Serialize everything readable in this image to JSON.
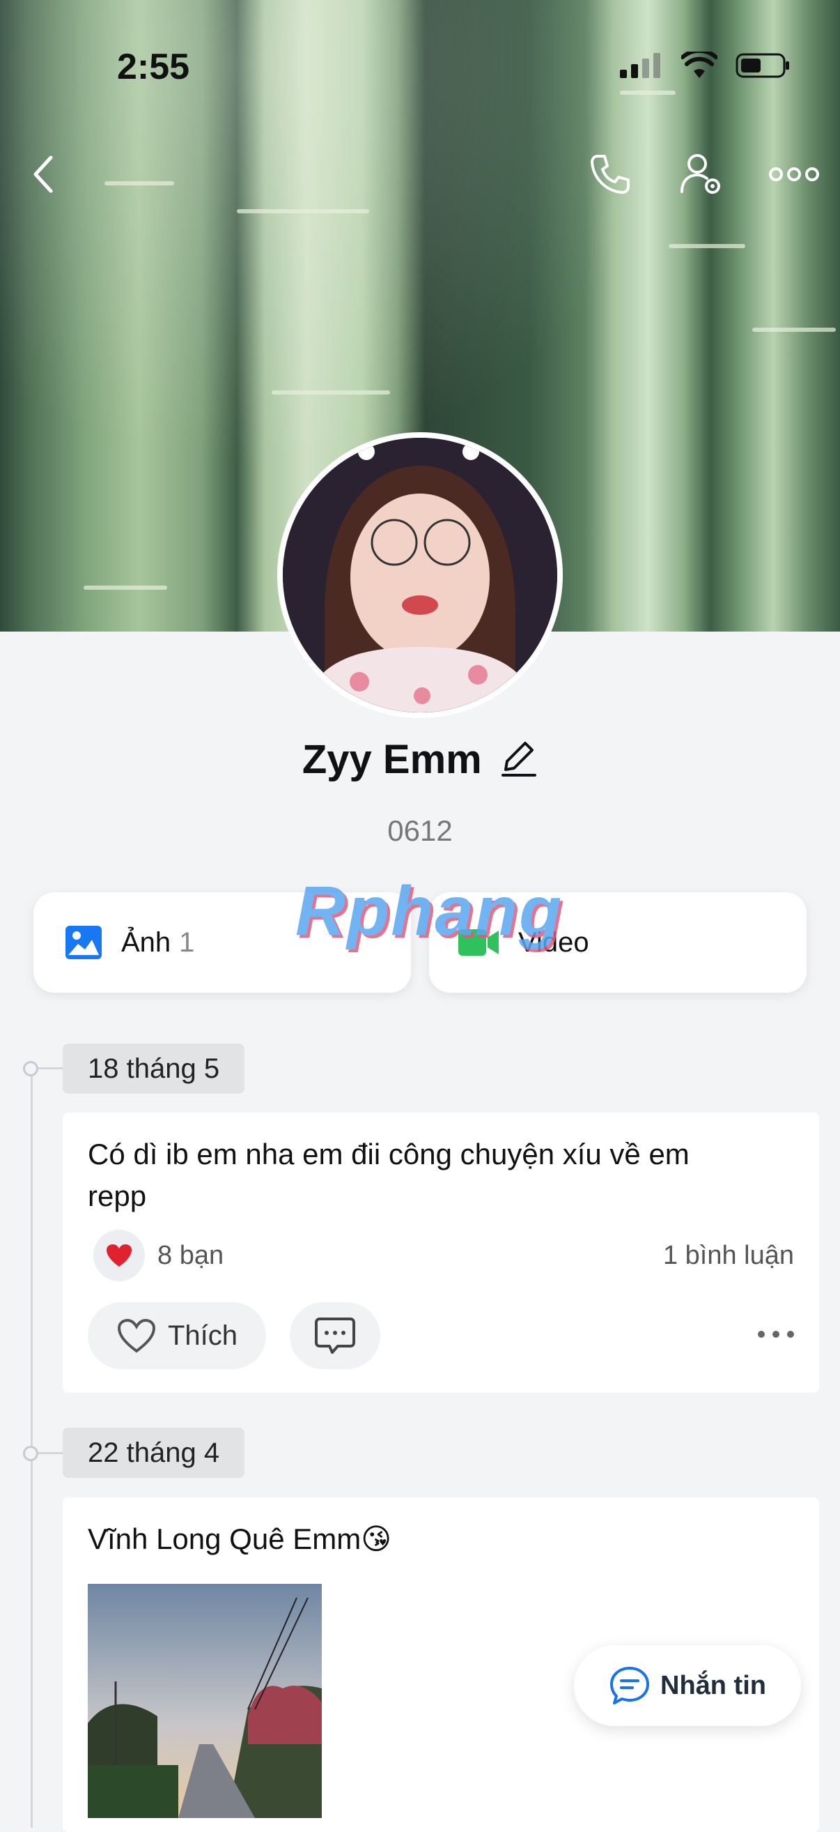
{
  "status_bar": {
    "time": "2:55"
  },
  "profile": {
    "name": "Zyy Emm",
    "bio": "0612"
  },
  "media": {
    "photos_label": "Ảnh",
    "photos_count": "1",
    "video_label": "Video"
  },
  "watermark": "Rphang",
  "posts": [
    {
      "date": "18 tháng 5",
      "text_line1": "Có dì ib em nha em đii công chuyện xíu về em",
      "text_line2": "repp",
      "reaction_icon": "heart",
      "reaction_count": "8 bạn",
      "comments": "1 bình luận",
      "like_label": "Thích"
    },
    {
      "date": "22 tháng 4",
      "text": "Vĩnh Long Quê Emm😘"
    }
  ],
  "fab": {
    "message_label": "Nhắn tin"
  },
  "colors": {
    "accent": "#1a73e8",
    "photo_icon": "#1877f2",
    "video_icon": "#2fc15b",
    "heart": "#e0212f"
  }
}
